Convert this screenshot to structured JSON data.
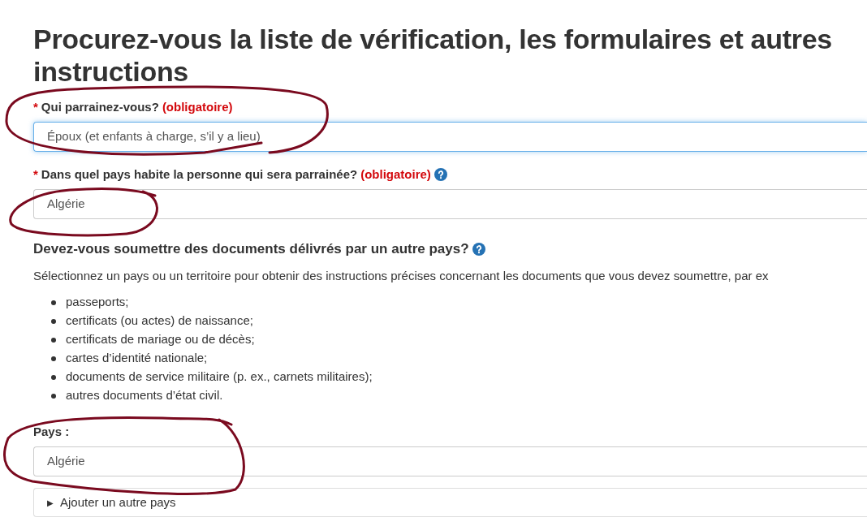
{
  "title": "Procurez-vous la liste de vérification, les formulaires et autres instructions",
  "sponsor_field": {
    "asterisk": "*",
    "label": "Qui parrainez-vous?",
    "required_note": "(obligatoire)",
    "value": "Époux (et enfants à charge, s’il y a lieu)",
    "focused": true
  },
  "residence_field": {
    "asterisk": "*",
    "label": "Dans quel pays habite la personne qui sera parrainée?",
    "required_note": "(obligatoire)",
    "value": "Algérie",
    "focused": false
  },
  "documents_section": {
    "heading": "Devez-vous soumettre des documents délivrés par un autre pays?",
    "intro": "Sélectionnez un pays ou un territoire pour obtenir des instructions précises concernant les documents que vous devez soumettre, par ex",
    "items": [
      "passeports;",
      "certificats (ou actes) de naissance;",
      "certificats de mariage ou de décès;",
      "cartes d’identité nationale;",
      "documents de service militaire (p. ex., carnets militaires);",
      "autres documents d’état civil."
    ],
    "country_label": "Pays :",
    "country_value": "Algérie",
    "add_country": {
      "marker": "▶",
      "label": "Ajouter un autre pays",
      "expanded": false
    }
  }
}
